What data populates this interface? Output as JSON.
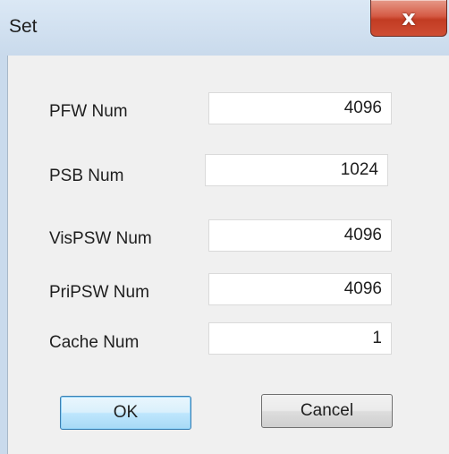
{
  "window": {
    "title": "Set",
    "close_glyph": "x"
  },
  "fields": [
    {
      "label": "PFW Num",
      "value": "4096"
    },
    {
      "label": "PSB Num",
      "value": "1024"
    },
    {
      "label": "VisPSW Num",
      "value": "4096"
    },
    {
      "label": "PriPSW Num",
      "value": "4096"
    },
    {
      "label": "Cache Num",
      "value": "1"
    }
  ],
  "buttons": {
    "ok_label": "OK",
    "cancel_label": "Cancel"
  },
  "colors": {
    "close_button": "#c23b22",
    "title_bar": "#dbe8f5",
    "dialog_bg": "#f0f0f0",
    "default_button_border": "#3c7fb1"
  },
  "icons": {
    "close": "close-icon"
  }
}
